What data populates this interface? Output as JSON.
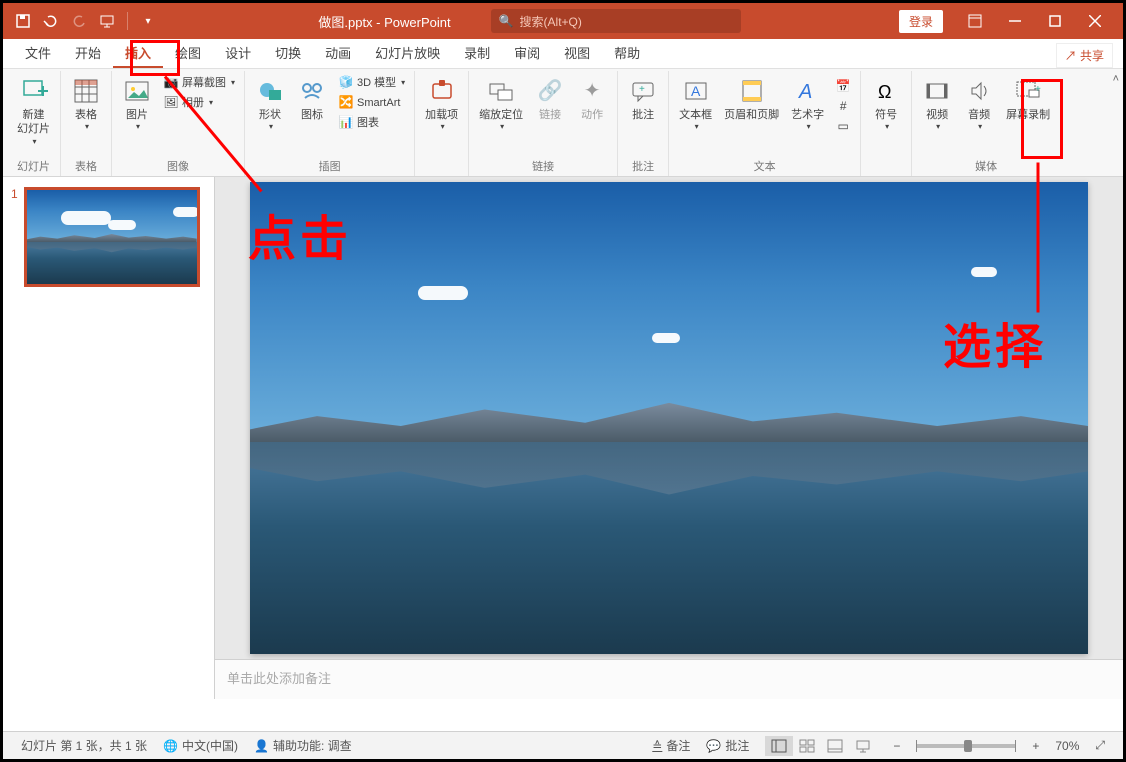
{
  "titlebar": {
    "doc_title": "做图.pptx - PowerPoint",
    "search_placeholder": "搜索(Alt+Q)",
    "login": "登录"
  },
  "tabs": {
    "file": "文件",
    "home": "开始",
    "insert": "插入",
    "draw": "绘图",
    "design": "设计",
    "transitions": "切换",
    "animations": "动画",
    "slideshow": "幻灯片放映",
    "record": "录制",
    "review": "审阅",
    "view": "视图",
    "help": "帮助",
    "share": "共享"
  },
  "ribbon": {
    "new_slide": "新建\n幻灯片",
    "slides_group": "幻灯片",
    "table": "表格",
    "tables_group": "表格",
    "picture": "图片",
    "screenshot": "屏幕截图",
    "album": "相册",
    "images_group": "图像",
    "shapes": "形状",
    "icons": "图标",
    "model3d": "3D 模型",
    "smartart": "SmartArt",
    "chart": "图表",
    "illustrations_group": "插图",
    "addins": "加载项",
    "zoom": "缩放定位",
    "link": "链接",
    "action": "动作",
    "links_group": "链接",
    "comment": "批注",
    "comments_group": "批注",
    "textbox": "文本框",
    "headerfooter": "页眉和页脚",
    "wordart": "艺术字",
    "text_group": "文本",
    "symbol": "符号",
    "video": "视频",
    "audio": "音频",
    "screenrec": "屏幕录制",
    "media_group": "媒体"
  },
  "thumbnails": {
    "slide1_num": "1"
  },
  "notes": {
    "placeholder": "单击此处添加备注"
  },
  "status": {
    "slide_count": "幻灯片 第 1 张，共 1 张",
    "language": "中文(中国)",
    "accessibility": "辅助功能: 调查",
    "notes_btn": "备注",
    "comments_btn": "批注",
    "zoom_pct": "70%"
  },
  "annotations": {
    "click": "点击",
    "select": "选择"
  }
}
